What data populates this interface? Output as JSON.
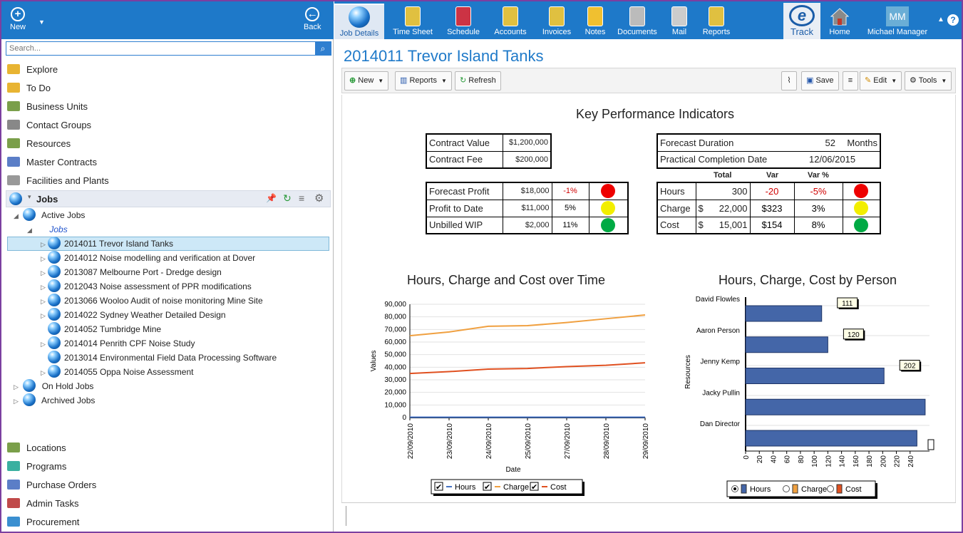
{
  "left_header": {
    "new_label": "New",
    "back_label": "Back"
  },
  "search": {
    "placeholder": "Search..."
  },
  "nav_top": [
    {
      "label": "Explore",
      "color": "#e8b432"
    },
    {
      "label": "To Do",
      "color": "#e8b432"
    },
    {
      "label": "Business Units",
      "color": "#7a9f4a"
    },
    {
      "label": "Contact Groups",
      "color": "#888888"
    },
    {
      "label": "Resources",
      "color": "#7a9f4a"
    },
    {
      "label": "Master Contracts",
      "color": "#5b7ec7"
    },
    {
      "label": "Facilities and Plants",
      "color": "#999999"
    }
  ],
  "jobs_header": {
    "label": "Jobs"
  },
  "tree": {
    "active_jobs": "Active Jobs",
    "jobs_folder": "Jobs",
    "items": [
      "2014011 Trevor Island Tanks",
      "2014012 Noise modelling and verification at Dover",
      "2013087 Melbourne Port - Dredge design",
      "2012043 Noise assessment of PPR modifications",
      "2013066 Wooloo Audit of noise monitoring Mine Site",
      "2014022 Sydney Weather Detailed Design",
      "2014052 Tumbridge Mine",
      "2014014 Penrith CPF Noise Study",
      "2013014 Environmental Field Data Processing Software",
      "2014055 Oppa Noise Assessment"
    ],
    "on_hold": "On Hold Jobs",
    "archived": "Archived Jobs"
  },
  "nav_bottom": [
    {
      "label": "Locations",
      "color": "#7a9f4a"
    },
    {
      "label": "Programs",
      "color": "#3ab0a0"
    },
    {
      "label": "Purchase Orders",
      "color": "#5b7ec7"
    },
    {
      "label": "Admin Tasks",
      "color": "#c04a4a"
    },
    {
      "label": "Procurement",
      "color": "#3a8fd0"
    }
  ],
  "top_nav": [
    {
      "label": "Job Details"
    },
    {
      "label": "Time Sheet"
    },
    {
      "label": "Schedule"
    },
    {
      "label": "Accounts"
    },
    {
      "label": "Invoices"
    },
    {
      "label": "Notes"
    },
    {
      "label": "Documents"
    },
    {
      "label": "Mail"
    },
    {
      "label": "Reports"
    }
  ],
  "top_right": {
    "etrack": "Track",
    "home": "Home",
    "user_initials": "MM",
    "user_name": "Michael Manager"
  },
  "page_title": "2014011 Trevor Island Tanks",
  "toolbar": {
    "new": "New",
    "reports": "Reports",
    "refresh": "Refresh",
    "save": "Save",
    "edit": "Edit",
    "tools": "Tools"
  },
  "kpi": {
    "title": "Key Performance Indicators",
    "contract_value_label": "Contract Value",
    "contract_value": "$1,200,000",
    "contract_fee_label": "Contract Fee",
    "contract_fee": "$200,000",
    "forecast_duration_label": "Forecast Duration",
    "forecast_duration": "52",
    "forecast_duration_unit": "Months",
    "completion_label": "Practical Completion Date",
    "completion": "12/06/2015",
    "left_rows": [
      {
        "label": "Forecast Profit",
        "value": "$18,000",
        "pct": "-1%",
        "pct_color": "#d00000",
        "status": "#ee0000"
      },
      {
        "label": "Profit to Date",
        "value": "$11,000",
        "pct": "5%",
        "pct_color": "#000000",
        "status": "#f2ee00"
      },
      {
        "label": "Unbilled WIP",
        "value": "$2,000",
        "pct": "11%",
        "pct_color": "#000000",
        "status": "#00aa44"
      }
    ],
    "right_headers": {
      "total": "Total",
      "var": "Var",
      "varpct": "Var %"
    },
    "right_rows": [
      {
        "label": "Hours",
        "currency": "",
        "total": "300",
        "var": "-20",
        "varpct": "-5%",
        "color": "#d00000",
        "status": "#ee0000"
      },
      {
        "label": "Charge",
        "currency": "$",
        "total": "22,000",
        "var": "$323",
        "varpct": "3%",
        "color": "#000000",
        "status": "#f2ee00"
      },
      {
        "label": "Cost",
        "currency": "$",
        "total": "15,001",
        "var": "$154",
        "varpct": "8%",
        "color": "#000000",
        "status": "#00aa44"
      }
    ]
  },
  "chart_data": [
    {
      "type": "line",
      "title": "Hours, Charge and Cost over Time",
      "xlabel": "Date",
      "ylabel": "Values",
      "x": [
        "22/09/2010",
        "23/09/2010",
        "24/09/2010",
        "25/09/2010",
        "27/09/2010",
        "28/09/2010",
        "29/09/2010"
      ],
      "ylim": [
        0,
        90000
      ],
      "yticks": [
        "0",
        "10,000",
        "20,000",
        "30,000",
        "40,000",
        "50,000",
        "60,000",
        "70,000",
        "80,000",
        "90,000"
      ],
      "series": [
        {
          "name": "Hours",
          "color": "#4472c4",
          "values": [
            300,
            300,
            300,
            300,
            300,
            300,
            300
          ]
        },
        {
          "name": "Charge",
          "color": "#f0a040",
          "values": [
            65000,
            68000,
            72500,
            73000,
            75500,
            78500,
            81500
          ]
        },
        {
          "name": "Cost",
          "color": "#e05020",
          "values": [
            35000,
            36500,
            38500,
            39000,
            40500,
            41500,
            43500
          ]
        }
      ],
      "legend_position": "bottom",
      "grid": true
    },
    {
      "type": "bar",
      "orientation": "horizontal",
      "title": "Hours, Charge, Cost by Person",
      "ylabel": "Resources",
      "categories": [
        "David Flowles",
        "Aaron Person",
        "Jenny Kemp",
        "Jacky Pullin",
        "Dan Director"
      ],
      "xlim": [
        0,
        260
      ],
      "xticks": [
        "0",
        "20",
        "40",
        "60",
        "80",
        "100",
        "120",
        "140",
        "160",
        "180",
        "200",
        "220",
        "240"
      ],
      "series": [
        {
          "name": "Hours",
          "color": "#4466a8",
          "values": [
            111,
            120,
            202,
            262,
            250
          ]
        }
      ],
      "data_labels": [
        "111",
        "120",
        "202",
        "",
        ""
      ],
      "legend": [
        "Hours",
        "Charge",
        "Cost"
      ],
      "legend_colors": [
        "#4466a8",
        "#f0a040",
        "#e05020"
      ],
      "legend_position": "bottom",
      "grid": true
    }
  ]
}
